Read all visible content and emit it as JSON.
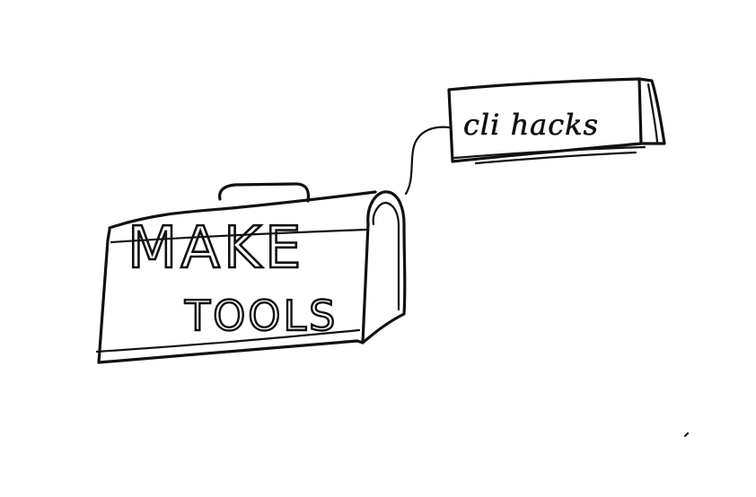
{
  "toolbox": {
    "line1": "MAKE",
    "line2": "TOOLS"
  },
  "tag": {
    "label": "cli hacks"
  },
  "colors": {
    "ink": "#111111",
    "paper": "#ffffff"
  }
}
